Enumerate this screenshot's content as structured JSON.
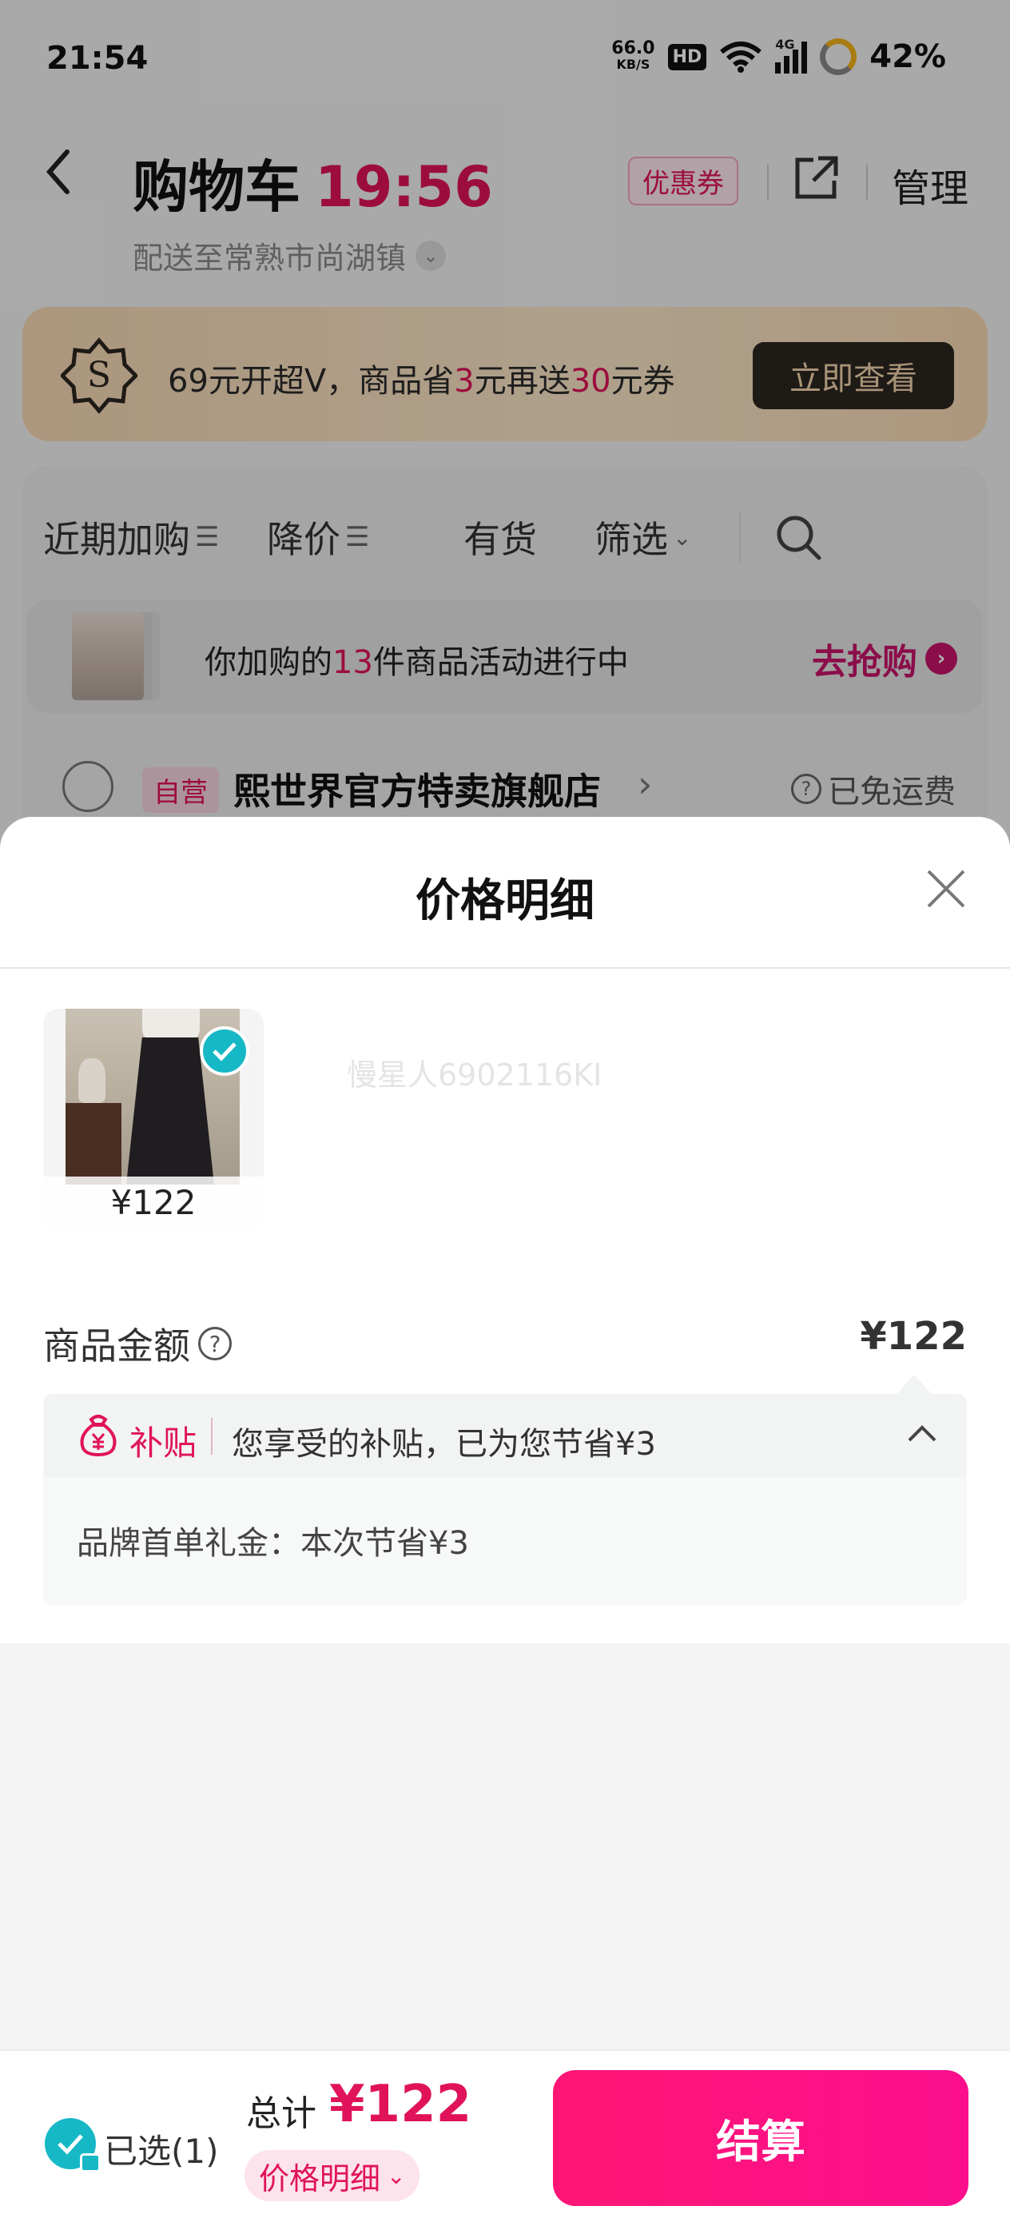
{
  "status_bar": {
    "time": "21:54",
    "net_speed_value": "66.0",
    "net_speed_unit": "KB/S",
    "hd": "HD",
    "network": "4G",
    "battery": "42%"
  },
  "header": {
    "title": "购物车",
    "timer": "19:56",
    "delivery": "配送至常熟市尚湖镇",
    "coupon": "优惠券",
    "manage": "管理"
  },
  "svip_banner": {
    "icon_letter": "S",
    "text_parts": [
      "69元开超V，商品省",
      "3",
      "元再送",
      "30",
      "元券"
    ],
    "button": "立即查看"
  },
  "filters": {
    "tabs": [
      "近期加购",
      "降价",
      "有货",
      "筛选"
    ]
  },
  "promo": {
    "text_parts": [
      "你加购的",
      "13",
      "件商品活动进行中"
    ],
    "action": "去抢购"
  },
  "store": {
    "badge": "自营",
    "name": "熙世界官方特卖旗舰店",
    "shipping": "已免运费"
  },
  "sheet": {
    "title": "价格明细",
    "product": {
      "price": "¥122",
      "watermark": "慢星人6902116KI"
    },
    "amount_label": "商品金额",
    "amount_value": "¥122",
    "subsidy": {
      "brand": "补贴",
      "desc": "您享受的补贴，已为您节省¥3",
      "detail": "品牌首单礼金：本次节省¥3"
    }
  },
  "bottom_bar": {
    "selected": "已选(1)",
    "total_label": "总计",
    "total_value": "¥122",
    "detail_link": "价格明细",
    "checkout": "结算"
  },
  "colors": {
    "accent": "#e0135a",
    "checkout_gradient_start": "#fe1675",
    "check_teal": "#17b8c6"
  }
}
